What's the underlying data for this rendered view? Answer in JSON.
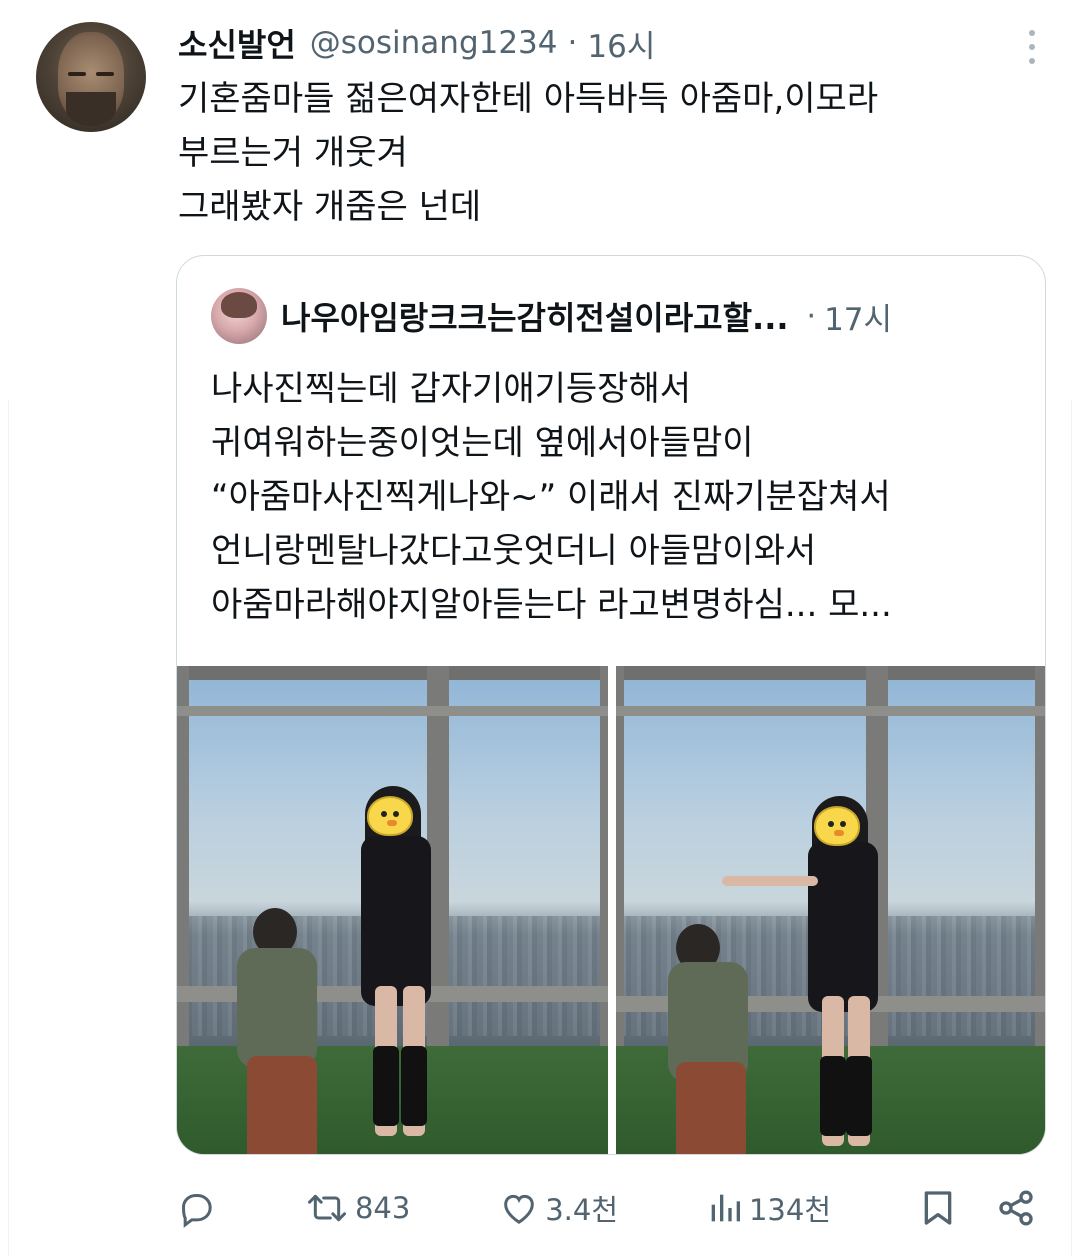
{
  "tweet": {
    "author_name": "소신발언",
    "author_handle": "@sosinang1234",
    "separator": "·",
    "time": "16시",
    "text_lines": [
      "기혼줌마들 젊은여자한테 아득바득 아줌마,이모라",
      "부르는거 개웃겨",
      "그래봤자 개줌은 넌데"
    ]
  },
  "quote": {
    "author_name": "나우아임랑크크는감히전설이라고할...",
    "separator": "·",
    "time": "17시",
    "text_lines": [
      "나사진찍는데 갑자기애기등장해서",
      "귀여워하는중이엇는데 옆에서아들맘이",
      "“아줌마사진찍게나와~” 이래서 진짜기분잡쳐서",
      "언니랑멘탈나갔다고웃엇더니 아들맘이와서",
      "아줌마라해야지알아듣는다 라고변명하심... 모..."
    ],
    "photos": [
      {
        "name": "photo-left"
      },
      {
        "name": "photo-right"
      }
    ]
  },
  "actions": {
    "reply_icon": "reply-icon",
    "retweet_icon": "retweet-icon",
    "retweet_count": "843",
    "like_icon": "heart-icon",
    "like_count": "3.4천",
    "views_icon": "views-icon",
    "views_count": "134천",
    "bookmark_icon": "bookmark-icon",
    "share_icon": "share-icon"
  },
  "colors": {
    "text_primary": "#0f1419",
    "text_secondary": "#536471",
    "border": "#cfd9de"
  }
}
